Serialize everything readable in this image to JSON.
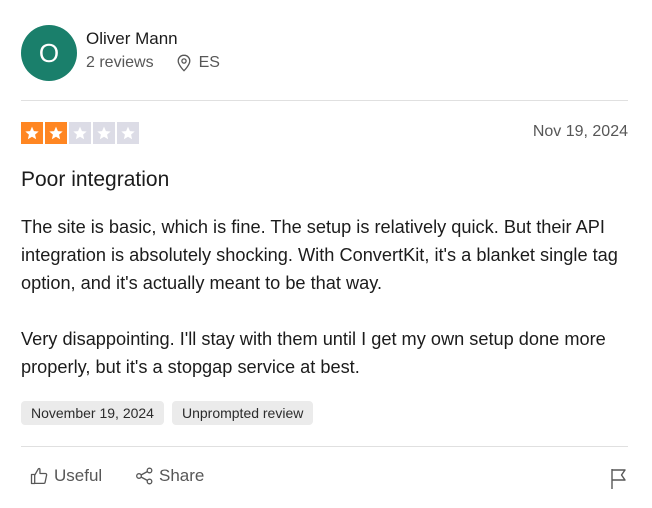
{
  "review": {
    "author": {
      "initial": "O",
      "name": "Oliver Mann",
      "reviews_count": "2 reviews",
      "country": "ES",
      "avatar_color": "#1a7f6b"
    },
    "rating": 2,
    "max_rating": 5,
    "star_color_filled": "#ff8622",
    "star_color_empty": "#dcdce6",
    "date": "Nov 19, 2024",
    "title": "Poor integration",
    "paragraphs": [
      "The site is basic, which is fine. The setup is relatively quick. But their API integration is absolutely shocking. With ConvertKit, it's a blanket single tag option, and it's actually meant to be that way.",
      "Very disappointing. I'll stay with them until I get my own setup done more properly, but it's a stopgap service at best."
    ],
    "tags": [
      "November 19, 2024",
      "Unprompted review"
    ]
  },
  "actions": {
    "useful_label": "Useful",
    "share_label": "Share",
    "useful_icon": "thumbs-up-icon",
    "share_icon": "share-icon",
    "flag_icon": "flag-icon"
  }
}
